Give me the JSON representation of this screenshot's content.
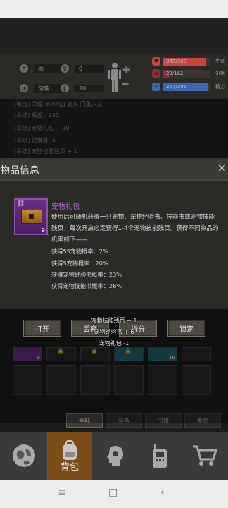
{
  "hud": {
    "weather": "雨",
    "radiation": "0",
    "weather_icon": "cloud-rain-icon",
    "time_of_day": "傍晚",
    "temperature": "20",
    "stats": [
      {
        "label": "生命",
        "text": "845/909",
        "value": 845,
        "max": 909,
        "color": "#c9453c"
      },
      {
        "label": "饥饿",
        "text": "23/162",
        "value": 23,
        "max": 162,
        "color": "#8a2e3c"
      },
      {
        "label": "精力",
        "text": "377/395",
        "value": 377,
        "max": 395,
        "color": "#3a68b0"
      }
    ]
  },
  "log": {
    "lines": [
      "[电台] 荣耀 :870战] 雇来 门重入又",
      "[系统] 瓶盖 - 980",
      "[系统] 宠物礼包 + 10",
      "[系统] 饱食度 -1",
      "[系统] 宠物技能残页 + 1"
    ]
  },
  "dialog": {
    "title": "物品信息",
    "close": "×",
    "item": {
      "name": "宠物礼包",
      "count": "9",
      "description": "使用后可随机获得一只宠物、宠物经验书、技能书或宠物技能残页，每次开启必定获得1-4个宠物技能残页。获得不同物品的机率如下——",
      "probabilities": [
        "获得SS宠物概率：2%",
        "获得S宠物概率：20%",
        "获得宠物经验书概率：23%",
        "获得宠物技能书概率：26%"
      ]
    },
    "buttons": {
      "open": "打开",
      "discard": "丢弃",
      "split": "拆分",
      "lock": "锁定"
    }
  },
  "toasts": [
    "宠物技能残页 + 1",
    "宠物经验书 + 6",
    "宠物礼包 -1"
  ],
  "inventory": {
    "counts": {
      "purple_slot": "9",
      "teal_slot": "16"
    }
  },
  "tabs": [
    "全部",
    "装备",
    "书籍",
    "食物"
  ],
  "nav": {
    "bag_label": "背包"
  }
}
